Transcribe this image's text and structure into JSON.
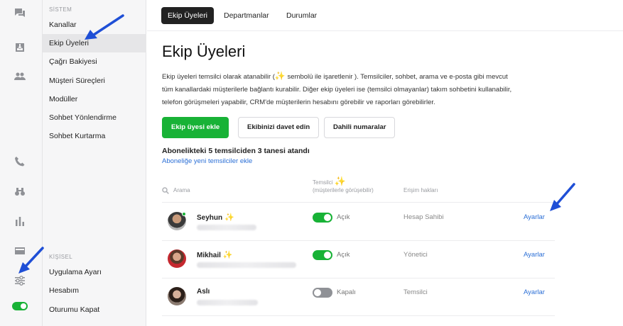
{
  "colors": {
    "accent": "#18b236",
    "link": "#2b6fd6",
    "sparkle": "#f3c21b",
    "annotation_arrow": "#1f4fd6"
  },
  "rail": {
    "icons": [
      "chat-icon",
      "inbox-icon",
      "people-icon",
      "phone-icon",
      "binoculars-icon",
      "bar-chart-icon",
      "card-icon",
      "sliders-icon",
      "status-toggle-icon"
    ],
    "status_toggle_on": true
  },
  "subnav": {
    "section_system": "SİSTEM",
    "system_items": [
      "Kanallar",
      "Ekip Üyeleri",
      "Çağrı Bakiyesi",
      "Müşteri Süreçleri",
      "Modüller",
      "Sohbet Yönlendirme",
      "Sohbet Kurtarma"
    ],
    "active_item": "Ekip Üyeleri",
    "section_personal": "KİŞİSEL",
    "personal_items": [
      "Uygulama Ayarı",
      "Hesabım",
      "Oturumu Kapat"
    ]
  },
  "tabs": [
    "Ekip Üyeleri",
    "Departmanlar",
    "Durumlar"
  ],
  "active_tab": "Ekip Üyeleri",
  "page": {
    "title": "Ekip Üyeleri",
    "desc_part1": "Ekip üyeleri temsilci olarak atanabilir (",
    "desc_sparkle": "✨",
    "desc_part2": " sembolü ile işaretlenir ). Temsilciler, sohbet, arama ve e-posta gibi mevcut tüm kanallardaki müşterilerle bağlantı kurabilir. Diğer ekip üyeleri ise (temsilci olmayanlar) takım sohbetini kullanabilir, telefon görüşmeleri yapabilir, CRM'de müşterilerin hesabını görebilir ve raporları görebilirler."
  },
  "actions": {
    "add_member": "Ekip üyesi ekle",
    "invite_team": "Ekibinizi davet edin",
    "extensions": "Dahili numaralar"
  },
  "subscription": {
    "summary": "Abonelikteki 5 temsilciden 3 tanesi atandı",
    "add_link": "Aboneliğe yeni temsilciler ekle"
  },
  "table": {
    "search_placeholder": "Arama",
    "col_agent": "Temsilci",
    "col_agent_sparkle": "✨",
    "col_agent_sub": "(müşterilerle görüşebilir)",
    "col_access": "Erişim hakları",
    "rows": [
      {
        "name": "Seyhun",
        "sparkle": "✨",
        "agent": true,
        "status": "Açık",
        "role": "Hesap Sahibi",
        "settings": "Ayarlar"
      },
      {
        "name": "Mikhail",
        "sparkle": "✨",
        "agent": true,
        "status": "Açık",
        "role": "Yönetici",
        "settings": "Ayarlar"
      },
      {
        "name": "Aslı",
        "sparkle": "",
        "agent": false,
        "status": "Kapalı",
        "role": "Temsilci",
        "settings": "Ayarlar"
      }
    ]
  }
}
